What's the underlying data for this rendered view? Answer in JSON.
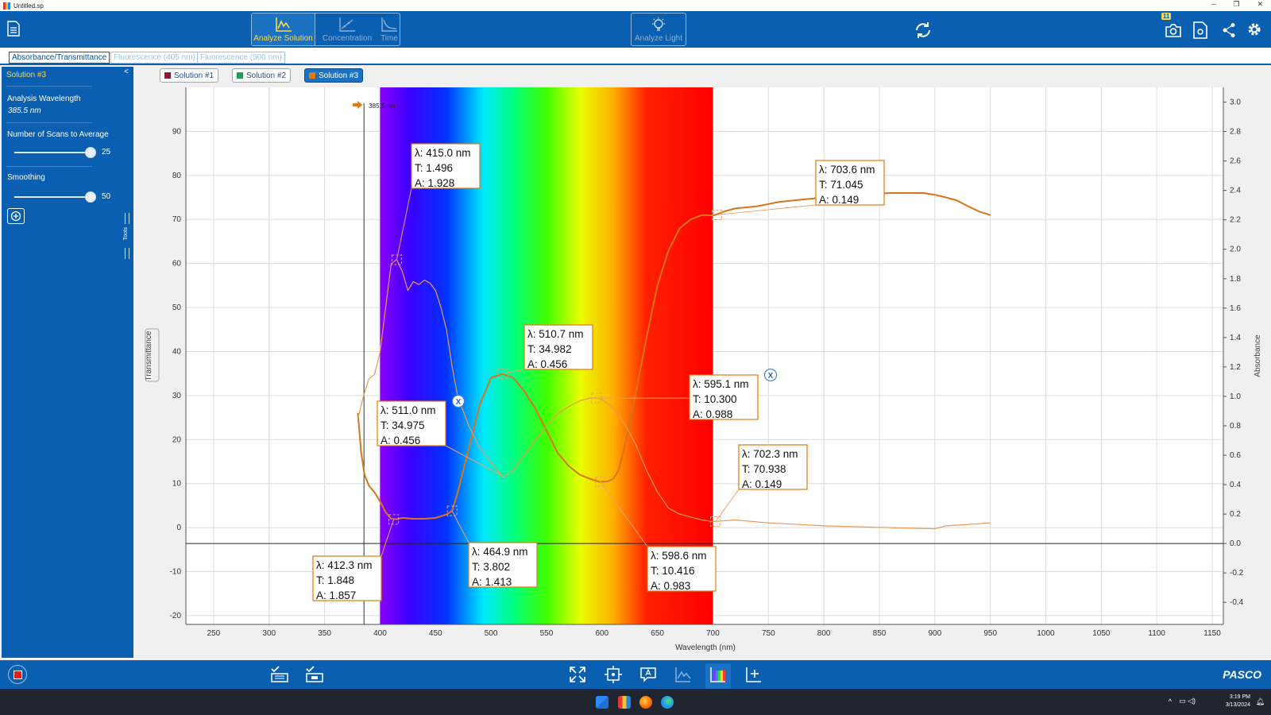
{
  "window": {
    "title": "Untitled.sp",
    "controls": [
      "–",
      "❐",
      "✕"
    ]
  },
  "toolbar": {
    "analyze_solution": "Analyze Solution",
    "concentration": "Concentration",
    "time": "Time",
    "analyze_light": "Analyze Light",
    "snapshot_badge": "11"
  },
  "tabs": [
    "Absorbance/Transmittance",
    "Fluorescence (405 nm)",
    "Fluorescence (500 nm)"
  ],
  "sidebar": {
    "title": "Solution #3",
    "collapse": "<",
    "analysis_wavelength_label": "Analysis Wavelength",
    "analysis_wavelength_value": "385.5 nm",
    "scans_label": "Number of Scans to Average",
    "scans_value": "25",
    "scans_fraction": 1.0,
    "smoothing_label": "Smoothing",
    "smoothing_value": "50",
    "smoothing_fraction": 1.0,
    "tools_label": "Tools"
  },
  "legend": [
    {
      "label": "Solution #1",
      "color": "#8b1a3a"
    },
    {
      "label": "Solution #2",
      "color": "#1f9e58"
    },
    {
      "label": "Solution #3",
      "color": "#e07a10"
    }
  ],
  "chart_data": {
    "type": "line",
    "xlabel": "Wavelength (nm)",
    "ylabel_left": "Transmittance",
    "ylabel_right": "Absorbance",
    "xlim": [
      225,
      1160
    ],
    "ylim_left": [
      -22,
      100
    ],
    "ylim_right": [
      -0.55,
      3.1
    ],
    "x_ticks": [
      250,
      300,
      350,
      400,
      450,
      500,
      550,
      600,
      650,
      700,
      750,
      800,
      850,
      900,
      950,
      1000,
      1050,
      1100,
      1150
    ],
    "y_ticks_left": [
      -20,
      -10,
      0,
      10,
      20,
      30,
      40,
      50,
      60,
      70,
      80,
      90
    ],
    "y_ticks_right": [
      -0.4,
      -0.2,
      0.0,
      0.2,
      0.4,
      0.6,
      0.8,
      1.0,
      1.2,
      1.4,
      1.6,
      1.8,
      2.0,
      2.2,
      2.4,
      2.6,
      2.8,
      3.0
    ],
    "grid": true,
    "spectrum_band": [
      400,
      700
    ],
    "analysis_marker": {
      "x": 385.5,
      "label": "385.5 nm"
    },
    "series": [
      {
        "name": "Solution #3",
        "axis": "left",
        "color": "#d9741a",
        "x": [
          380,
          383,
          386,
          390,
          395,
          400,
          405,
          410,
          415,
          420,
          430,
          440,
          450,
          460,
          465,
          470,
          480,
          490,
          500,
          510,
          520,
          530,
          540,
          550,
          560,
          570,
          580,
          590,
          598,
          605,
          610,
          615,
          620,
          630,
          640,
          650,
          660,
          670,
          680,
          690,
          700,
          703,
          710,
          720,
          740,
          760,
          780,
          800,
          820,
          840,
          860,
          880,
          890,
          900,
          910,
          920,
          930,
          940,
          950
        ],
        "y": [
          26,
          17,
          12,
          9.5,
          8,
          6,
          3.5,
          2,
          1.9,
          2.2,
          2,
          2,
          2.2,
          3,
          3.8,
          8,
          18,
          28,
          34,
          34.9,
          34,
          31,
          27,
          22,
          17,
          14,
          12,
          11,
          10.4,
          10.5,
          11,
          13,
          18,
          30,
          43,
          55,
          63,
          68,
          70,
          71,
          70.9,
          71.1,
          71.8,
          72.5,
          73,
          74,
          74.5,
          75,
          75.5,
          75.8,
          76,
          76,
          76,
          75.6,
          75,
          74.3,
          73,
          71.8,
          71
        ]
      },
      {
        "name": "Solution #3 absorbance",
        "axis": "right",
        "color": "#e89a56",
        "x": [
          380,
          385,
          390,
          395,
          400,
          405,
          410,
          415,
          420,
          425,
          430,
          435,
          440,
          445,
          450,
          455,
          460,
          465,
          470,
          480,
          490,
          500,
          511,
          520,
          530,
          540,
          550,
          560,
          570,
          580,
          590,
          595,
          600,
          610,
          620,
          630,
          640,
          650,
          660,
          670,
          680,
          690,
          700,
          702,
          720,
          750,
          800,
          850,
          900,
          910,
          930,
          950
        ],
        "y": [
          0.85,
          1.0,
          1.12,
          1.15,
          1.3,
          1.6,
          1.9,
          1.93,
          1.85,
          1.72,
          1.78,
          1.76,
          1.79,
          1.77,
          1.72,
          1.6,
          1.45,
          1.2,
          1.0,
          0.8,
          0.65,
          0.55,
          0.45,
          0.5,
          0.6,
          0.7,
          0.8,
          0.88,
          0.93,
          0.97,
          0.99,
          0.99,
          0.98,
          0.92,
          0.82,
          0.68,
          0.5,
          0.35,
          0.24,
          0.2,
          0.18,
          0.16,
          0.15,
          0.15,
          0.16,
          0.14,
          0.12,
          0.11,
          0.1,
          0.12,
          0.13,
          0.14
        ]
      }
    ],
    "annotations": [
      {
        "lines": [
          "λ: 415.0 nm",
          "T: 1.496",
          "A: 1.928"
        ],
        "close": false
      },
      {
        "lines": [
          "λ: 703.6 nm",
          "T: 71.045",
          "A: 0.149"
        ],
        "close": false
      },
      {
        "lines": [
          "λ: 510.7 nm",
          "T: 34.982",
          "A: 0.456"
        ],
        "close": false
      },
      {
        "lines": [
          "λ: 595.1 nm",
          "T: 10.300",
          "A: 0.988"
        ],
        "close": true
      },
      {
        "lines": [
          "λ: 511.0 nm",
          "T: 34.975",
          "A: 0.456"
        ],
        "close": true
      },
      {
        "lines": [
          "λ: 702.3 nm",
          "T: 70.938",
          "A: 0.149"
        ],
        "close": false
      },
      {
        "lines": [
          "λ: 412.3 nm",
          "T: 1.848",
          "A: 1.857"
        ],
        "close": false
      },
      {
        "lines": [
          "λ: 464.9 nm",
          "T: 3.802",
          "A: 1.413"
        ],
        "close": false
      },
      {
        "lines": [
          "λ: 598.6 nm",
          "T: 10.416",
          "A: 0.983"
        ],
        "close": false
      }
    ]
  },
  "bottombar": {
    "brand": "PASCO"
  },
  "taskbar": {
    "time": "3:19 PM",
    "date": "3/13/2024"
  }
}
